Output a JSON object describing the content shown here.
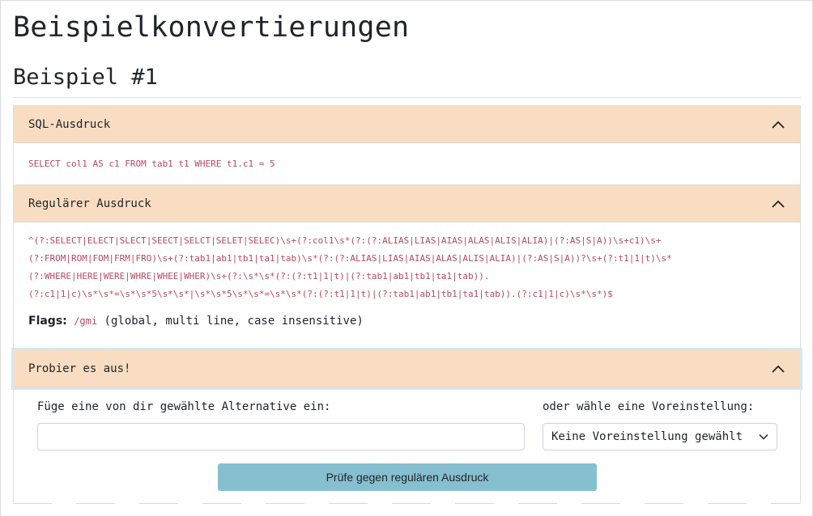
{
  "page": {
    "title": "Beispielkonvertierungen",
    "example_heading": "Beispiel #1"
  },
  "sql_section": {
    "title": "SQL-Ausdruck",
    "query": "SELECT col1 AS c1 FROM tab1 t1 WHERE t1.c1 = 5"
  },
  "regex_section": {
    "title": "Regulärer Ausdruck",
    "lines": [
      "^(?:SELECT|ELECT|SLECT|SEECT|SELCT|SELET|SELEC)\\s+(?:col1\\s*(?:(?:ALIAS|LIAS|AIAS|ALAS|ALIS|ALIA)|(?:AS|S|A))\\s+c1)\\s+",
      "(?:FROM|ROM|FOM|FRM|FRO)\\s+(?:tab1|ab1|tb1|ta1|tab)\\s*(?:(?:ALIAS|LIAS|AIAS|ALAS|ALIS|ALIA)|(?:AS|S|A))?\\s+(?:t1|1|t)\\s*",
      "(?:WHERE|HERE|WERE|WHRE|WHEE|WHER)\\s+(?:\\s*\\s*(?:(?:t1|1|t)|(?:tab1|ab1|tb1|ta1|tab)).",
      "(?:c1|1|c)\\s*\\s*=\\s*\\s*5\\s*\\s*|\\s*\\s*5\\s*\\s*=\\s*\\s*(?:(?:t1|1|t)|(?:tab1|ab1|tb1|ta1|tab)).(?:c1|1|c)\\s*\\s*)$"
    ],
    "flags_label": "Flags:",
    "flags_value": "/gmi",
    "flags_desc": " (global, multi line, case insensitive)"
  },
  "try_section": {
    "title": "Probier es aus!",
    "input_label": "Füge eine von dir gewählte Alternative ein:",
    "input_value": "",
    "preset_label": "oder wähle eine Voreinstellung:",
    "preset_selected": "Keine Voreinstellung gewählt",
    "check_button": "Prüfe gegen regulären Ausdruck"
  },
  "icons": {
    "collapse": "chevron-up-icon",
    "dropdown": "chevron-down-icon"
  },
  "colors": {
    "accordion_header": "#f8ddc2",
    "code_text": "#b44b63",
    "button": "#86bfcf"
  }
}
